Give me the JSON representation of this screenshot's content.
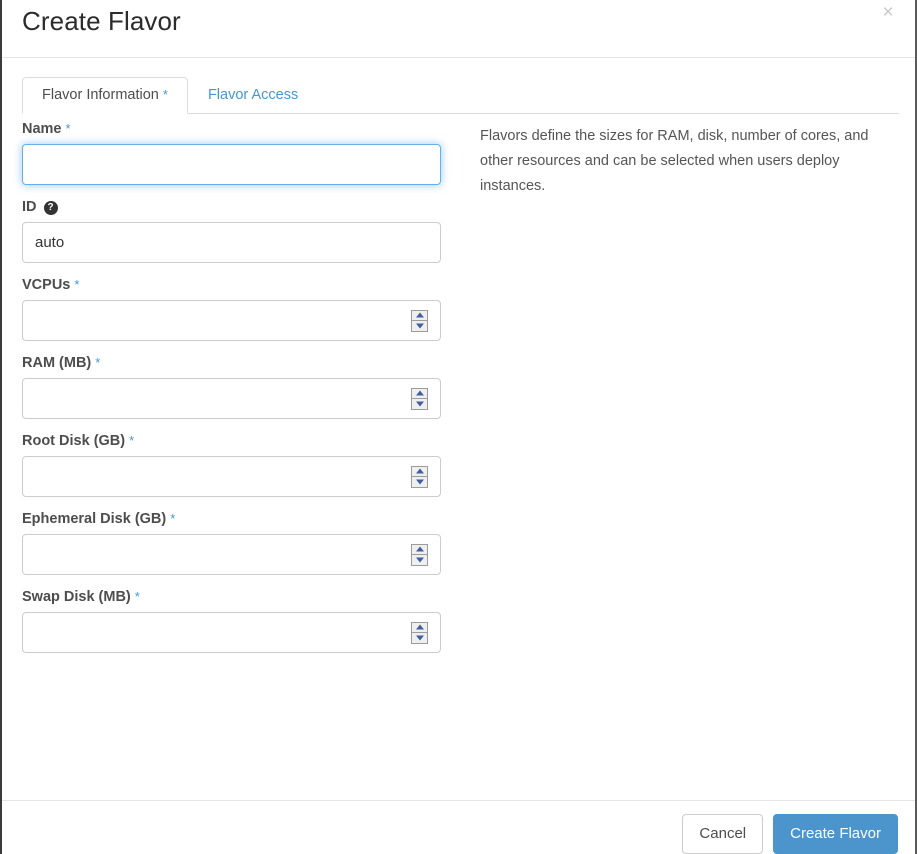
{
  "modal": {
    "title": "Create Flavor",
    "close_label": "×"
  },
  "tabs": [
    {
      "label": "Flavor Information",
      "required_marker": "*",
      "active": true
    },
    {
      "label": "Flavor Access",
      "required_marker": "",
      "active": false
    }
  ],
  "help": {
    "description": "Flavors define the sizes for RAM, disk, number of cores, and other resources and can be selected when users deploy instances."
  },
  "form": {
    "fields": [
      {
        "key": "name",
        "label": "Name",
        "required_marker": "*",
        "type": "text",
        "value": "",
        "placeholder": "",
        "focused": true,
        "has_help_icon": false
      },
      {
        "key": "id",
        "label": "ID",
        "required_marker": "",
        "type": "text",
        "value": "auto",
        "placeholder": "",
        "focused": false,
        "has_help_icon": true,
        "help_icon_glyph": "?"
      },
      {
        "key": "vcpus",
        "label": "VCPUs",
        "required_marker": "*",
        "type": "number",
        "value": "",
        "placeholder": "",
        "focused": false,
        "has_help_icon": false
      },
      {
        "key": "ram",
        "label": "RAM (MB)",
        "required_marker": "*",
        "type": "number",
        "value": "",
        "placeholder": "",
        "focused": false,
        "has_help_icon": false
      },
      {
        "key": "root_disk",
        "label": "Root Disk (GB)",
        "required_marker": "*",
        "type": "number",
        "value": "",
        "placeholder": "",
        "focused": false,
        "has_help_icon": false
      },
      {
        "key": "ephemeral_disk",
        "label": "Ephemeral Disk (GB)",
        "required_marker": "*",
        "type": "number",
        "value": "",
        "placeholder": "",
        "focused": false,
        "has_help_icon": false
      },
      {
        "key": "swap_disk",
        "label": "Swap Disk (MB)",
        "required_marker": "*",
        "type": "number",
        "value": "",
        "placeholder": "",
        "focused": false,
        "has_help_icon": false
      }
    ]
  },
  "footer": {
    "cancel_label": "Cancel",
    "submit_label": "Create Flavor"
  },
  "colors": {
    "primary_blue": "#4b95cc",
    "link_blue": "#4398d1",
    "focus_border": "#66afe9",
    "label_text": "#4d4d4d",
    "spinner_arrow": "#3f5f9c"
  }
}
